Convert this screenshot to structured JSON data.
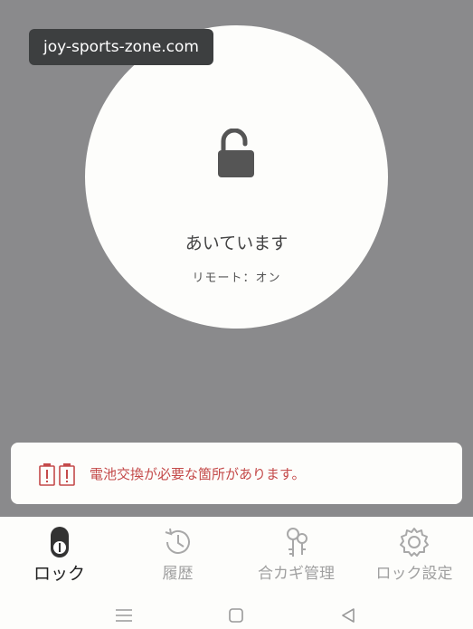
{
  "watermark": {
    "text": "joy-sports-zone.com"
  },
  "lock": {
    "status": "あいています",
    "remote": "リモート：オン",
    "icon": "unlocked-padlock-icon"
  },
  "alert": {
    "text": "電池交換が必要な箇所があります。",
    "icon": "battery-warning-icon",
    "color": "#c44a4a"
  },
  "tabs": [
    {
      "label": "ロック",
      "icon": "lock-toggle-icon",
      "active": true
    },
    {
      "label": "履歴",
      "icon": "history-clock-icon",
      "active": false
    },
    {
      "label": "合カギ管理",
      "icon": "keys-icon",
      "active": false
    },
    {
      "label": "ロック設定",
      "icon": "gear-icon",
      "active": false
    }
  ],
  "system_nav": [
    "menu-icon",
    "home-icon",
    "back-icon"
  ]
}
